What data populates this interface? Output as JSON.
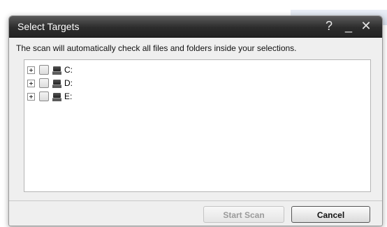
{
  "dialog": {
    "title": "Select Targets",
    "help_icon": "?",
    "minimize_icon": "_",
    "close_icon": "✕",
    "instructions": "The scan will automatically check all files and folders inside your selections."
  },
  "tree": {
    "items": [
      {
        "label": "C:",
        "checked": false,
        "expanded": false,
        "icon": "drive-icon"
      },
      {
        "label": "D:",
        "checked": false,
        "expanded": false,
        "icon": "drive-icon"
      },
      {
        "label": "E:",
        "checked": false,
        "expanded": false,
        "icon": "drive-icon"
      }
    ]
  },
  "buttons": {
    "start_scan": "Start Scan",
    "start_scan_enabled": false,
    "cancel": "Cancel"
  },
  "colors": {
    "titlebar": "#2c2c2c",
    "dialog_bg": "#efefef",
    "disabled_text": "#9a9a9a"
  }
}
